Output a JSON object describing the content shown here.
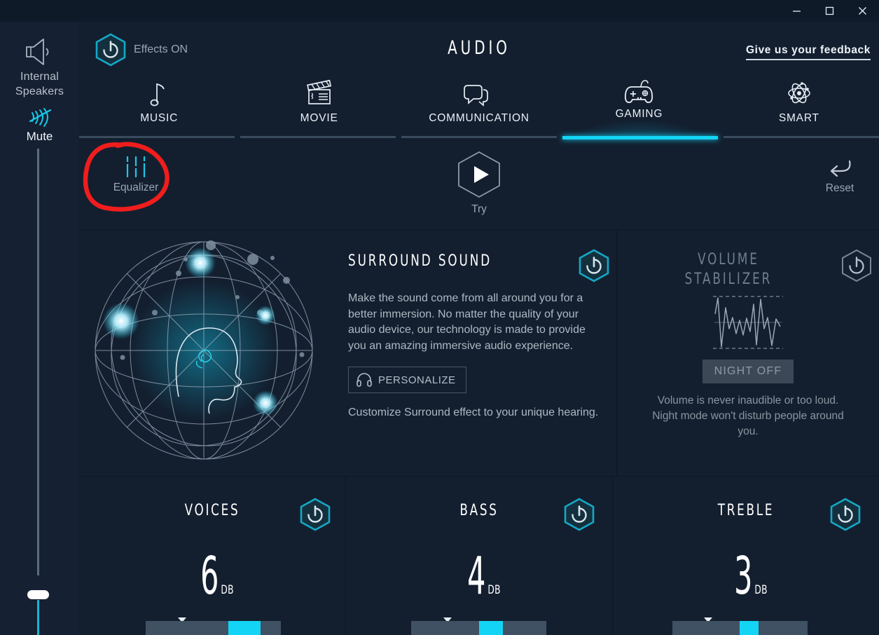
{
  "window": {
    "controls": [
      {
        "name": "minimize",
        "glyph": "minimize-icon"
      },
      {
        "name": "maximize",
        "glyph": "maximize-icon"
      },
      {
        "name": "close",
        "glyph": "close-icon"
      }
    ]
  },
  "sidebar": {
    "device_icon": "speaker-icon",
    "device_label_line1": "Internal",
    "device_label_line2": "Speakers",
    "mute_icon": "mute-icon",
    "mute_label": "Mute",
    "volume_slider": {
      "value_percent": 8
    }
  },
  "header": {
    "power_icon": "power-icon",
    "effects_label": "Effects ON",
    "title": "AUDIO",
    "feedback_link": "Give us your feedback"
  },
  "tabs": [
    {
      "label": "MUSIC",
      "icon": "music-note-icon",
      "active": false
    },
    {
      "label": "MOVIE",
      "icon": "clapperboard-icon",
      "active": false
    },
    {
      "label": "COMMUNICATION",
      "icon": "speech-bubbles-icon",
      "active": false
    },
    {
      "label": "GAMING",
      "icon": "gamepad-icon",
      "active": true
    },
    {
      "label": "SMART",
      "icon": "atom-icon",
      "active": false
    }
  ],
  "actions": {
    "equalizer": {
      "label": "Equalizer",
      "icon": "equalizer-sliders-icon",
      "annotated": true
    },
    "try": {
      "label": "Try",
      "icon": "play-icon"
    },
    "reset": {
      "label": "Reset",
      "icon": "undo-arrow-icon"
    }
  },
  "annotation": {
    "color": "#f01d1d",
    "shape": "hand-drawn-circle",
    "target": "Equalizer"
  },
  "surround": {
    "title": "SURROUND SOUND",
    "toggle_icon": "power-icon",
    "toggle_state": "on",
    "description": "Make the sound come from all around you for a better immersion. No matter the quality of your audio device, our technology is made to provide you an amazing immersive audio experience.",
    "personalize_label": "PERSONALIZE",
    "personalize_icon": "headphones-icon",
    "sub_description": "Customize Surround effect to your unique hearing.",
    "graphic": "surround-sphere-head-graphic"
  },
  "stabilizer": {
    "title_line1": "VOLUME",
    "title_line2": "STABILIZER",
    "toggle_icon": "power-icon",
    "toggle_state": "off",
    "waveform_icon": "waveform-icon",
    "night_button_label": "NIGHT OFF",
    "description": "Volume is never inaudible or too loud. Night mode won't disturb people around you."
  },
  "bands": [
    {
      "title": "VOICES",
      "value": "6",
      "unit": "DB",
      "toggle_state": "on",
      "toggle_icon": "power-icon",
      "slider_percent": 62
    },
    {
      "title": "BASS",
      "value": "4",
      "unit": "DB",
      "toggle_state": "on",
      "toggle_icon": "power-icon",
      "slider_percent": 58
    },
    {
      "title": "TREBLE",
      "value": "3",
      "unit": "DB",
      "toggle_state": "on",
      "toggle_icon": "power-icon",
      "slider_percent": 55
    }
  ],
  "colors": {
    "background": "#131f2f",
    "sidebar": "#152032",
    "titlebar": "#0f1a28",
    "accent_cyan": "#14d4f5",
    "toggle_on": "#1a9bb5",
    "toggle_off": "#8b96a3",
    "annotation_red": "#f01d1d"
  }
}
